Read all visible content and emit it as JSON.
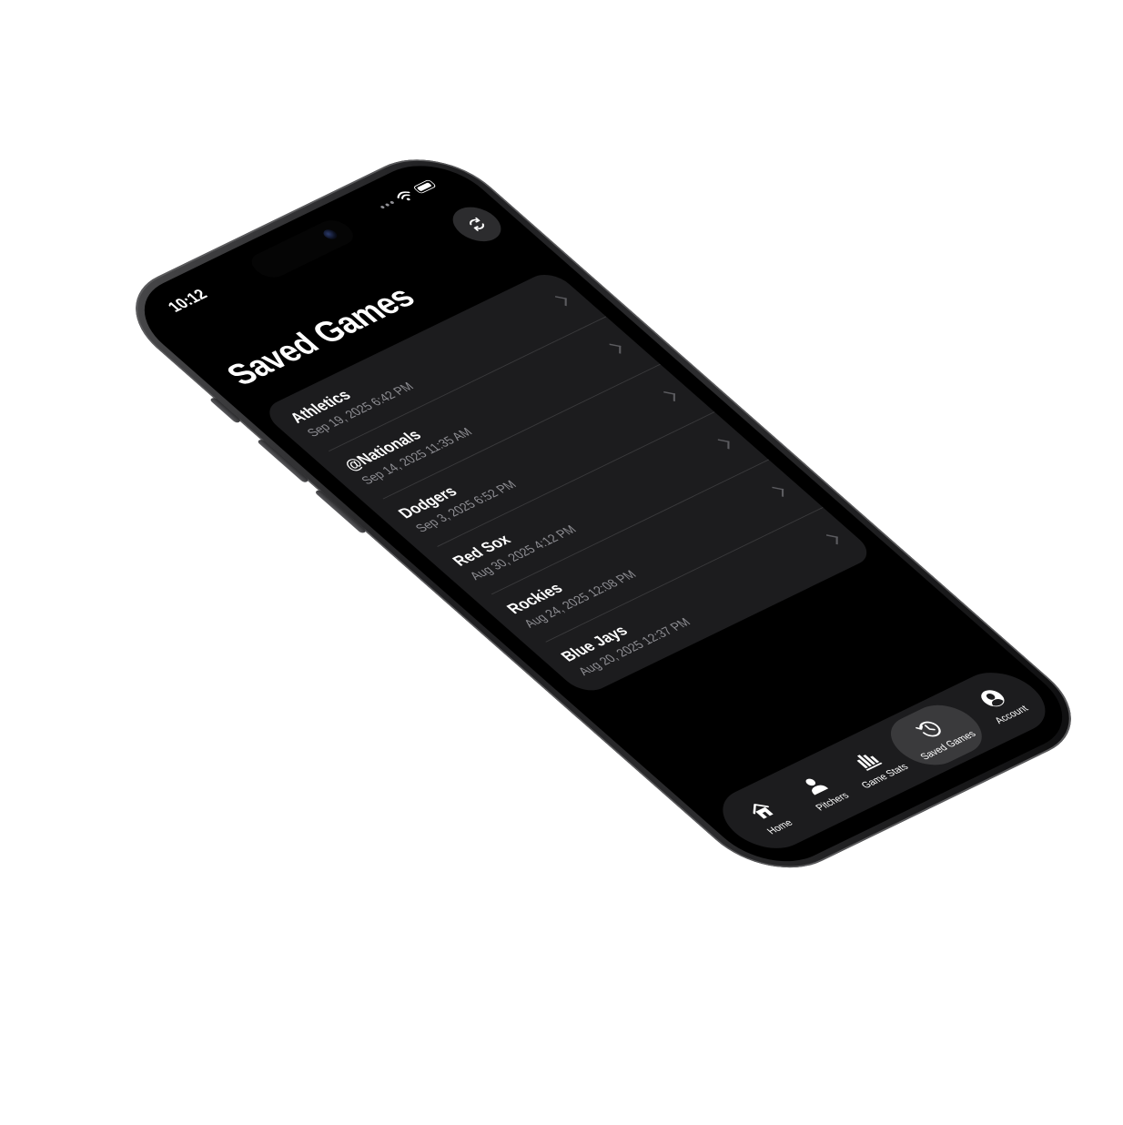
{
  "status_bar": {
    "time": "10:12"
  },
  "header": {
    "title": "Saved Games",
    "refresh_icon": "refresh-icon"
  },
  "saved_games": [
    {
      "title": "Athletics",
      "date": "Sep 19, 2025 6:42 PM"
    },
    {
      "title": "@Nationals",
      "date": "Sep 14, 2025 11:35 AM"
    },
    {
      "title": "Dodgers",
      "date": "Sep 3, 2025 6:52 PM"
    },
    {
      "title": "Red Sox",
      "date": "Aug 30, 2025 4:12 PM"
    },
    {
      "title": "Rockies",
      "date": "Aug 24, 2025 12:08 PM"
    },
    {
      "title": "Blue Jays",
      "date": "Aug 20, 2025 12:37 PM"
    }
  ],
  "tab_bar": {
    "tabs": [
      {
        "label": "Home",
        "icon": "home-icon"
      },
      {
        "label": "Pitchers",
        "icon": "person-icon"
      },
      {
        "label": "Game Stats",
        "icon": "bar-chart-icon"
      },
      {
        "label": "Saved Games",
        "icon": "history-icon",
        "active": true
      },
      {
        "label": "Account",
        "icon": "account-icon"
      }
    ]
  },
  "colors": {
    "background": "#000000",
    "card": "#1c1c1e",
    "separator": "#3a3a3c",
    "secondary_text": "#8e8e93",
    "active_tab": "#3a3a3c"
  }
}
